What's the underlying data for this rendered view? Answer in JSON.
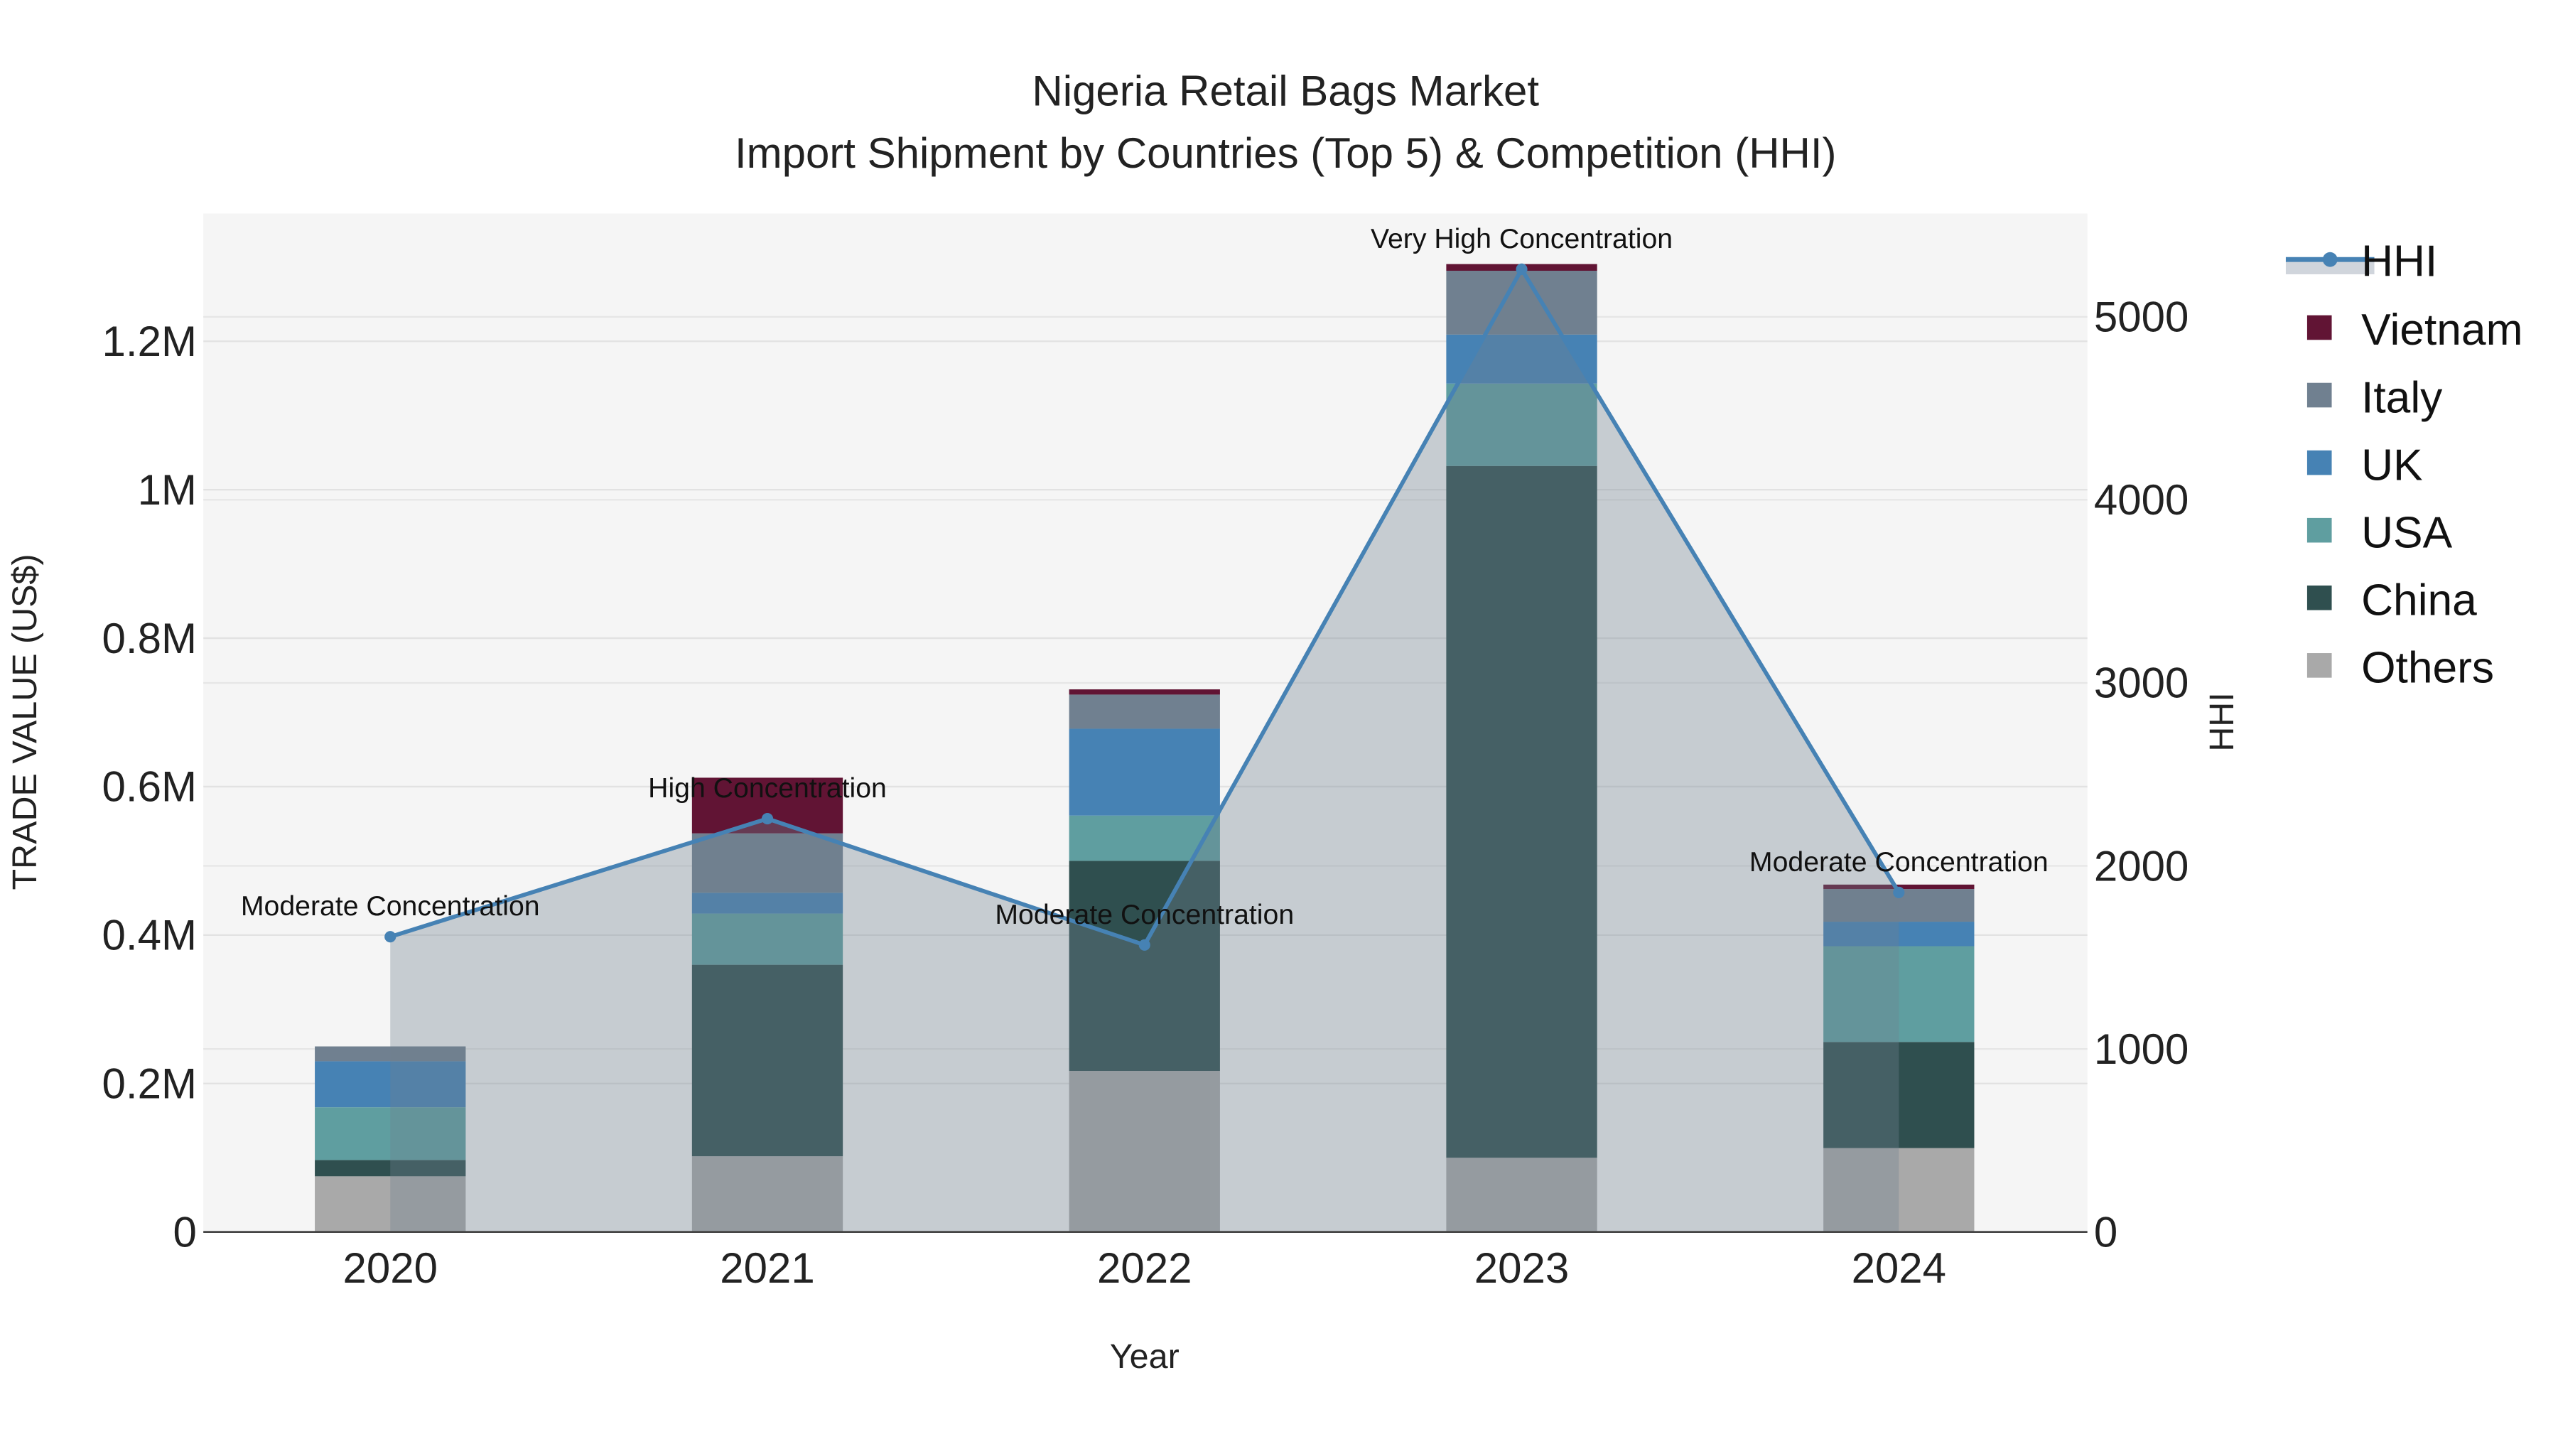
{
  "chart_data": {
    "type": "bar",
    "title": "Nigeria Retail Bags Market",
    "subtitle": "Import Shipment by Countries (Top 5) & Competition (HHI)",
    "xlabel": "Year",
    "ylabel": "TRADE VALUE (US$)",
    "y2label": "HHI",
    "categories": [
      "2020",
      "2021",
      "2022",
      "2023",
      "2024"
    ],
    "ylim": [
      0,
      1.372
    ],
    "y_unit": "M",
    "yticks": [
      0,
      0.2,
      0.4,
      0.6,
      0.8,
      1,
      1.2
    ],
    "ytick_labels": [
      "0",
      "0.2M",
      "0.4M",
      "0.6M",
      "0.8M",
      "1M",
      "1.2M"
    ],
    "y2lim": [
      0,
      5564
    ],
    "y2ticks": [
      0,
      1000,
      2000,
      3000,
      4000,
      5000
    ],
    "y2tick_labels": [
      "0",
      "1000",
      "2000",
      "3000",
      "4000",
      "5000"
    ],
    "grid": true,
    "legend_position": "right",
    "series": [
      {
        "name": "Others",
        "color": "#A9A9A9",
        "values": [
          0.075,
          0.102,
          0.217,
          0.1,
          0.113
        ]
      },
      {
        "name": "China",
        "color": "#2F4F4F",
        "values": [
          0.022,
          0.258,
          0.283,
          0.932,
          0.143
        ]
      },
      {
        "name": "USA",
        "color": "#5F9EA0",
        "values": [
          0.071,
          0.069,
          0.061,
          0.111,
          0.129
        ]
      },
      {
        "name": "UK",
        "color": "#4682B4",
        "values": [
          0.062,
          0.028,
          0.117,
          0.066,
          0.033
        ]
      },
      {
        "name": "Italy",
        "color": "#708090",
        "values": [
          0.02,
          0.08,
          0.046,
          0.086,
          0.044
        ]
      },
      {
        "name": "Vietnam",
        "color": "#611434",
        "values": [
          0.0,
          0.075,
          0.007,
          0.009,
          0.006
        ]
      }
    ],
    "hhi": {
      "name": "HHI",
      "color": "#4682B4",
      "values": [
        1613,
        2258,
        1568,
        5260,
        1855
      ],
      "annotations": [
        "Moderate Concentration",
        "High Concentration",
        "Moderate Concentration",
        "Very High Concentration",
        "Moderate Concentration"
      ]
    },
    "legend_order": [
      "HHI",
      "Vietnam",
      "Italy",
      "UK",
      "USA",
      "China",
      "Others"
    ]
  }
}
